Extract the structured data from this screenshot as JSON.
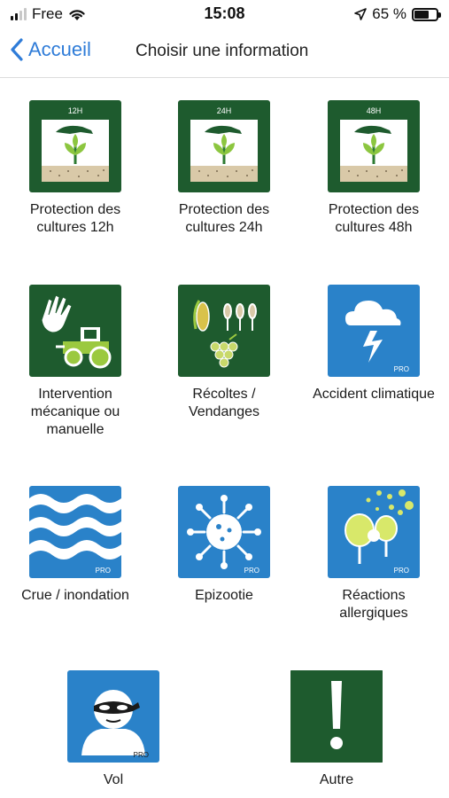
{
  "status": {
    "carrier": "Free",
    "time": "15:08",
    "battery": "65 %",
    "battery_level": 0.65
  },
  "nav": {
    "back_label": "Accueil",
    "title": "Choisir une information"
  },
  "colors": {
    "green": "#1e5b2e",
    "blue": "#2a82c9",
    "accent": "#2f7cd8"
  },
  "items": [
    {
      "label": "Protection des cultures 12h",
      "tag": "12H",
      "icon": "crop-protection-icon"
    },
    {
      "label": "Protection des cultures 24h",
      "tag": "24H",
      "icon": "crop-protection-icon"
    },
    {
      "label": "Protection des cultures 48h",
      "tag": "48H",
      "icon": "crop-protection-icon"
    },
    {
      "label": "Intervention mécanique ou manuelle",
      "icon": "tractor-hand-icon"
    },
    {
      "label": "Récoltes / Vendanges",
      "icon": "harvest-icon"
    },
    {
      "label": "Accident climatique",
      "badge": "PRO",
      "icon": "storm-cloud-icon"
    },
    {
      "label": "Crue / inondation",
      "badge": "PRO",
      "icon": "flood-waves-icon"
    },
    {
      "label": "Epizootie",
      "badge": "PRO",
      "icon": "virus-icon"
    },
    {
      "label": "Réactions allergiques",
      "badge": "PRO",
      "icon": "pollen-trees-icon"
    },
    {
      "label": "Vol",
      "badge": "PRO",
      "icon": "thief-icon"
    },
    {
      "label": "Autre",
      "icon": "exclamation-icon"
    }
  ]
}
